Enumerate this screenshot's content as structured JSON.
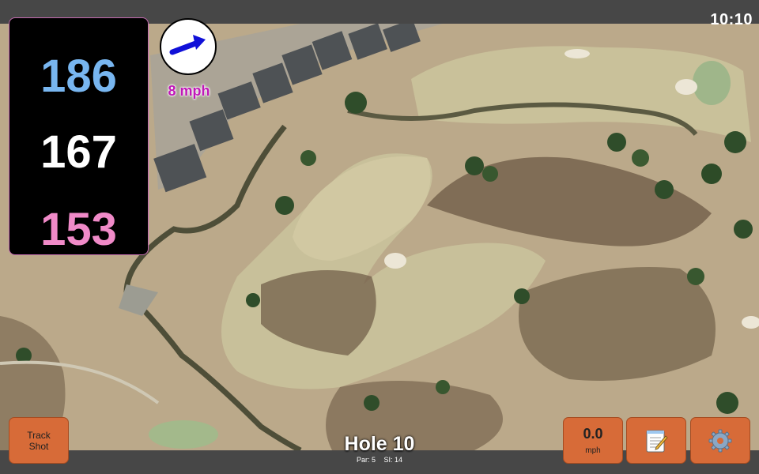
{
  "status_bar": {
    "time": "10:10"
  },
  "distances": {
    "back": "186",
    "middle": "167",
    "front": "153"
  },
  "wind": {
    "speed_label": "8 mph",
    "direction_icon": "arrow-right-icon"
  },
  "hole": {
    "title": "Hole 10",
    "par_label": "Par: 5",
    "si_label": "SI: 14"
  },
  "buttons": {
    "track_shot": {
      "line1": "Track",
      "line2": "Shot"
    },
    "speed": {
      "value": "0.0",
      "unit": "mph"
    },
    "notes": {
      "icon": "notepad-icon"
    },
    "settings": {
      "icon": "gear-icon"
    }
  },
  "colors": {
    "back_distance": "#78b6f0",
    "middle_distance": "#ffffff",
    "front_distance": "#f08ac8",
    "button_accent": "#d76b38",
    "wind_text": "#c017b8"
  }
}
